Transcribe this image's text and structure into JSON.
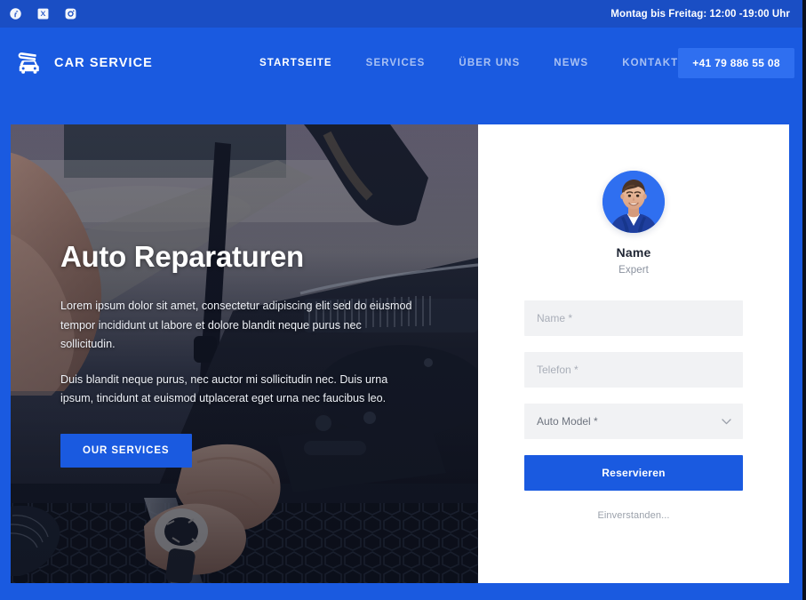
{
  "topbar": {
    "socials": [
      {
        "name": "facebook-icon",
        "label": "Facebook"
      },
      {
        "name": "x-twitter-icon",
        "label": "X"
      },
      {
        "name": "instagram-icon",
        "label": "Instagram"
      }
    ],
    "hours": "Montag bis Freitag: 12:00 -19:00 Uhr"
  },
  "header": {
    "brand_name": "CAR SERVICE",
    "brand_icon": "car-wrench-logo-icon",
    "nav": [
      {
        "label": "STARTSEITE",
        "active": true
      },
      {
        "label": "SERVICES",
        "active": false
      },
      {
        "label": "ÜBER UNS",
        "active": false
      },
      {
        "label": "NEWS",
        "active": false
      },
      {
        "label": "KONTAKT",
        "active": false
      }
    ],
    "phone": "+41 79 886 55 08"
  },
  "hero": {
    "title": "Auto Reparaturen",
    "paragraph_1": "Lorem ipsum dolor sit amet, consectetur adipiscing elit sed do eiusmod tempor incididunt ut labore et dolore blandit neque purus nec sollicitudin.",
    "paragraph_2": "Duis blandit neque purus, nec auctor mi sollicitudin nec. Duis urna ipsum, tincidunt at euismod utplacerat eget urna nec faucibus leo.",
    "cta_label": "OUR SERVICES",
    "image_alt": "mechanic-working-on-car-engine-photo"
  },
  "booking": {
    "avatar_alt": "mechanic-portrait-avatar",
    "name": "Name",
    "role": "Expert",
    "fields": [
      {
        "name": "name-input",
        "placeholder": "Name *",
        "value": ""
      },
      {
        "name": "telefon-input",
        "placeholder": "Telefon *",
        "value": ""
      }
    ],
    "select": {
      "name": "auto-model-select",
      "value": "Auto Model *",
      "chevron": "chevron-down-icon"
    },
    "submit_label": "Reservieren",
    "consent_text": "Einverstanden..."
  },
  "colors": {
    "brand_blue": "#1a5ae0",
    "topbar_blue": "#1a4ec4",
    "button_blue": "#2f6ff0",
    "field_gray": "#f1f2f4",
    "text_dark": "#1f2533",
    "text_muted": "#8a919e"
  }
}
